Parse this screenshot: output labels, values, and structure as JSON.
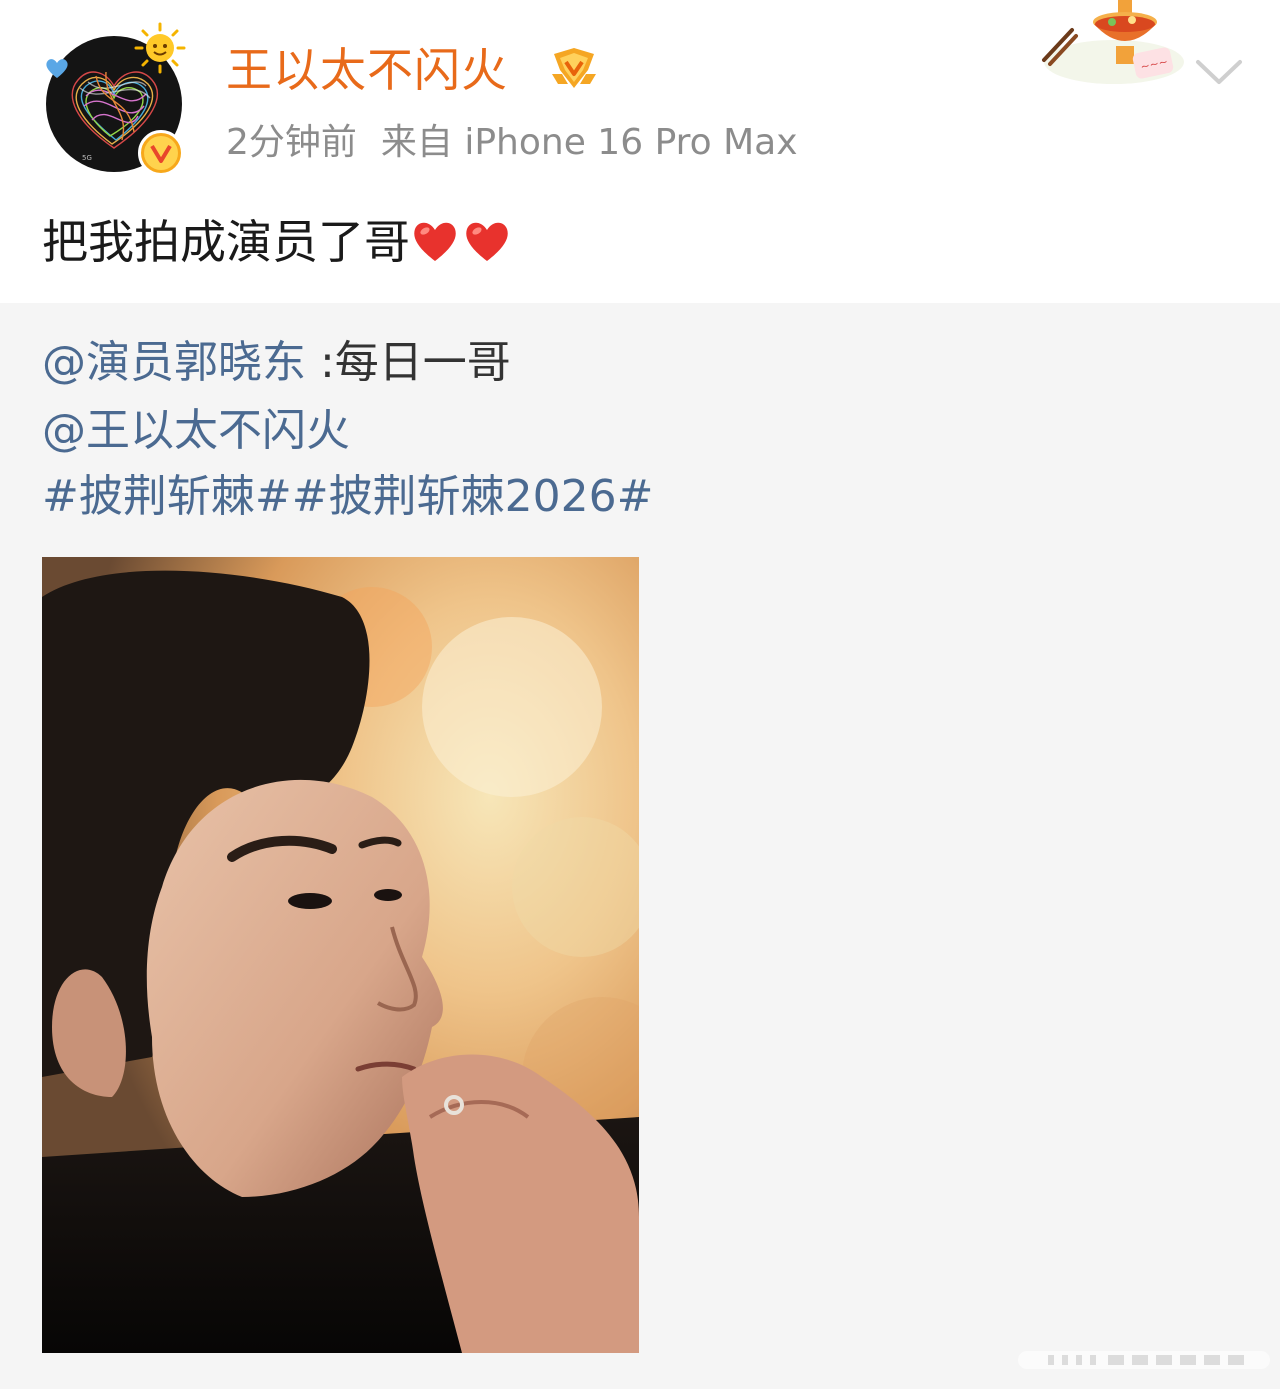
{
  "post": {
    "author": {
      "name": "王以太不闪火",
      "verified": true,
      "avatar": "avatar-image"
    },
    "meta": {
      "time": "2分钟前",
      "source": "来自 iPhone 16 Pro Max"
    },
    "text": "把我拍成演员了哥",
    "text_emoji": [
      "heart-emoji",
      "heart-emoji"
    ]
  },
  "repost": {
    "line1": {
      "mention": "@演员郭晓东",
      "text": " :每日一哥"
    },
    "line2": {
      "mention": "@王以太不闪火"
    },
    "line3": {
      "hashtag1": "#披荆斩棘#",
      "hashtag2": "#披荆斩棘2026#"
    },
    "image": "portrait-photo"
  },
  "colors": {
    "username": "#e86a1a",
    "link": "#4b6a91",
    "meta": "#8c8c8c",
    "repost_bg": "#f5f5f5"
  },
  "icons": {
    "sun": "sun-icon",
    "heart": "heart-icon",
    "verified": "verified-v-icon",
    "level": "level-badge-icon",
    "hotpot": "hotpot-decoration-icon",
    "chevron": "chevron-down-icon"
  }
}
